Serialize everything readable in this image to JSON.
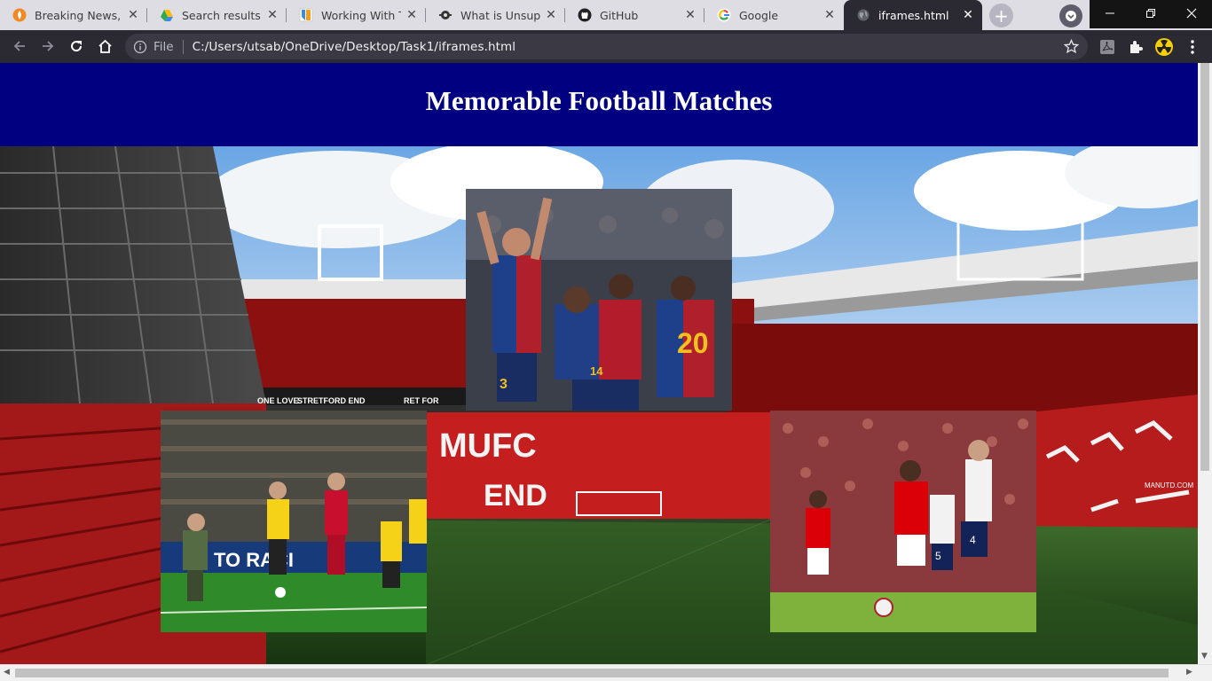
{
  "browser": {
    "tabs": [
      {
        "title": "Breaking News, W",
        "icon": "news-favicon-icon",
        "active": false
      },
      {
        "title": "Search results - G",
        "icon": "drive-favicon-icon",
        "active": false
      },
      {
        "title": "Working With Te",
        "icon": "bookmark-favicon-icon",
        "active": false
      },
      {
        "title": "What is Unsuperv",
        "icon": "site-favicon-icon",
        "active": false
      },
      {
        "title": "GitHub",
        "icon": "github-icon",
        "active": false
      },
      {
        "title": "Google",
        "icon": "google-icon",
        "active": false
      },
      {
        "title": "iframes.html",
        "icon": "globe-icon",
        "active": true
      }
    ],
    "address_bar": {
      "scheme_label": "File",
      "url": "C:/Users/utsab/OneDrive/Desktop/Task1/iframes.html"
    },
    "colors": {
      "tab_strip": "#dedde3",
      "toolbar": "#2b2a33"
    }
  },
  "page": {
    "title": "Memorable Football Matches",
    "header_color": "#000080",
    "frames": [
      {
        "name": "barcelona-celebration",
        "caption": "",
        "jersey_numbers": [
          "3",
          "14",
          "20"
        ]
      },
      {
        "name": "bayern-dortmund-final",
        "caption": "TO RACI"
      },
      {
        "name": "arsenal-tottenham-derby",
        "caption": "",
        "jersey_numbers": [
          "5",
          "4"
        ]
      }
    ],
    "stadium_signage": [
      "STRETFORD END",
      "ONE LOVE",
      "MUFC",
      "RET FOR",
      "END",
      "MANUTD.COM"
    ]
  }
}
